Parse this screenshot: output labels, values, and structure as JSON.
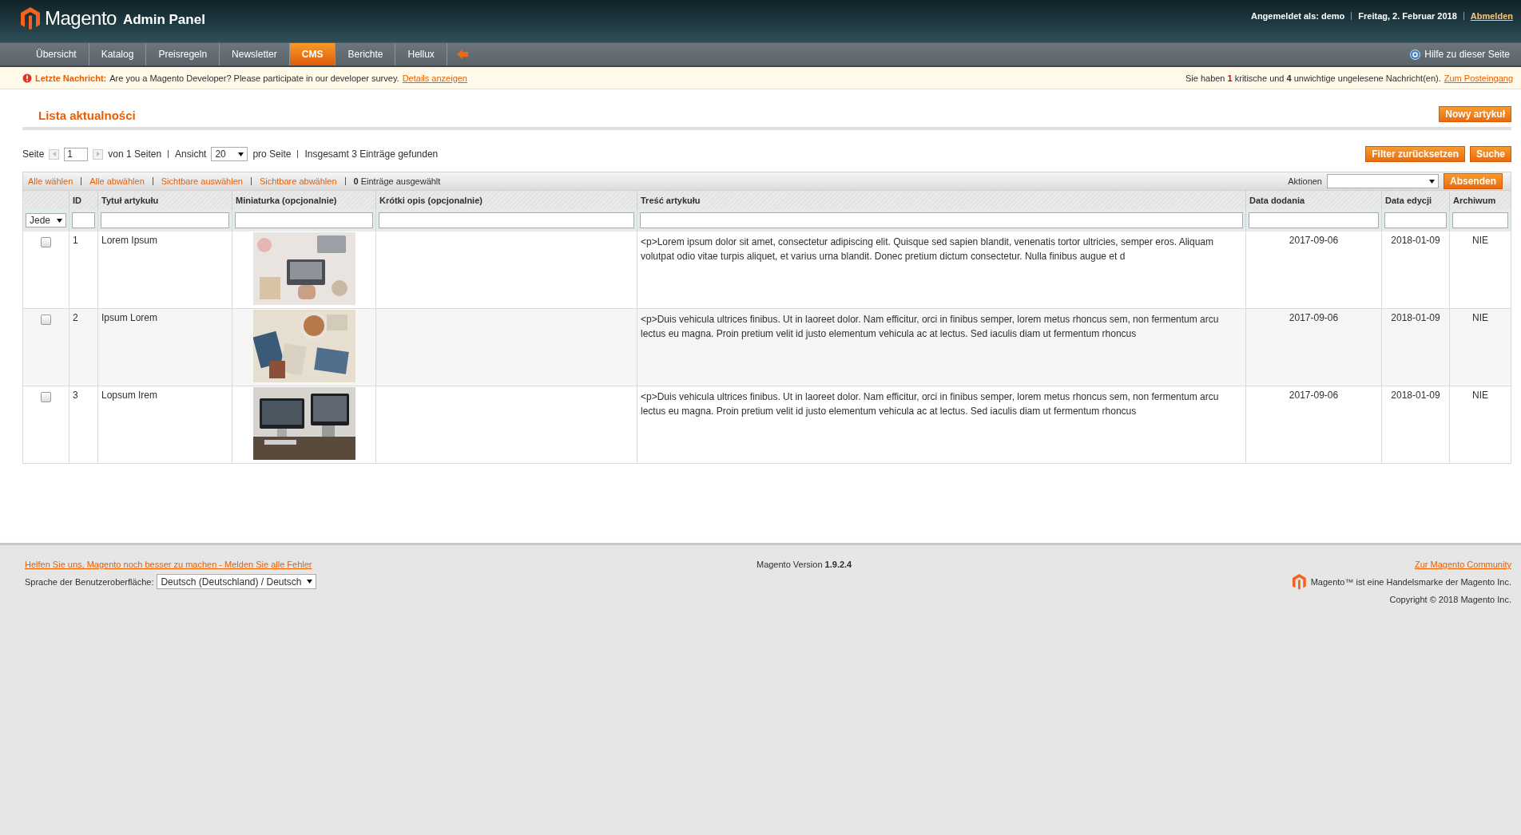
{
  "header": {
    "logo_text": "Magento",
    "logo_suffix": "Admin Panel",
    "user": "Angemeldet als: demo",
    "date": "Freitag, 2. Februar 2018",
    "logout": "Abmelden"
  },
  "nav": {
    "items": [
      {
        "label": "Übersicht",
        "selected": false
      },
      {
        "label": "Katalog",
        "selected": false
      },
      {
        "label": "Preisregeln",
        "selected": false
      },
      {
        "label": "Newsletter",
        "selected": false
      },
      {
        "label": "CMS",
        "selected": true
      },
      {
        "label": "Berichte",
        "selected": false
      },
      {
        "label": "Hellux",
        "selected": false
      }
    ],
    "help": "Hilfe zu dieser Seite"
  },
  "notice": {
    "label": "Letzte Nachricht:",
    "text": "Are you a Magento Developer? Please participate in our developer survey.",
    "link": "Details anzeigen",
    "summary": "Sie haben **1** kritische und **4** unwichtige ungelesene Nachricht(en).",
    "inbox_link": "Zum Posteingang"
  },
  "page_title": "Lista aktualności",
  "new_button": "Nowy artykuł",
  "pager": {
    "page_label": "Seite",
    "page": "1",
    "of": "von 1 Seiten",
    "view_label": "Ansicht",
    "per_page": "20",
    "per_page_label": "pro Seite",
    "total": "Insgesamt 3 Einträge gefunden"
  },
  "filter_buttons": [
    "Filter zurücksetzen",
    "Suche"
  ],
  "massaction": {
    "links": [
      "Alle wählen",
      "Alle abwählen",
      "Sichtbare auswählen",
      "Sichtbare abwählen"
    ],
    "count": "**0** Einträge ausgewählt",
    "actions_label": "Aktionen",
    "submit": "Absenden"
  },
  "table": {
    "columns": [
      "",
      "ID",
      "Tytuł artykułu",
      "Miniaturka (opcjonalnie)",
      "Krótki opis (opcjonalnie)",
      "Treść artykułu",
      "Data dodania",
      "Data edycji",
      "Archiwum"
    ],
    "filter_select": "Jede",
    "rows": [
      {
        "checked": false,
        "id": "1",
        "title": "Lorem Ipsum",
        "content": "<p>Lorem ipsum dolor sit amet, consectetur adipiscing elit. Quisque sed sapien blandit, venenatis tortor ultricies, semper eros. Aliquam volutpat odio vitae turpis aliquet, et varius urna blandit. Donec pretium dictum consectetur. Nulla finibus augue et d",
        "added": "2017-09-06",
        "edited": "2018-01-09",
        "archive": "NIE"
      },
      {
        "checked": false,
        "id": "2",
        "title": "Ipsum Lorem",
        "content": "<p>Duis vehicula ultrices finibus. Ut in laoreet dolor. Nam efficitur, orci in finibus semper, lorem metus rhoncus sem, non fermentum arcu lectus eu magna. Proin pretium velit id justo elementum vehicula ac at lectus. Sed iaculis diam ut fermentum rhoncus",
        "added": "2017-09-06",
        "edited": "2018-01-09",
        "archive": "NIE"
      },
      {
        "checked": false,
        "id": "3",
        "title": "Lopsum Irem",
        "content": "<p>Duis vehicula ultrices finibus. Ut in laoreet dolor. Nam efficitur, orci in finibus semper, lorem metus rhoncus sem, non fermentum arcu lectus eu magna. Proin pretium velit id justo elementum vehicula ac at lectus. Sed iaculis diam ut fermentum rhoncus",
        "added": "2017-09-06",
        "edited": "2018-01-09",
        "archive": "NIE"
      }
    ]
  },
  "footer": {
    "bug_link": "Helfen Sie uns, Magento noch besser zu machen - Melden Sie alle Fehler",
    "lang_label": "Sprache der Benutzeroberfläche:",
    "lang": "Deutsch (Deutschland) / Deutsch",
    "version": "Magento Version **1.9.2.4**",
    "community_link": "Zur Magento Community",
    "trademark": "Magento™ ist eine Handelsmarke der Magento Inc.",
    "copyright": "Copyright © 2018 Magento Inc."
  }
}
